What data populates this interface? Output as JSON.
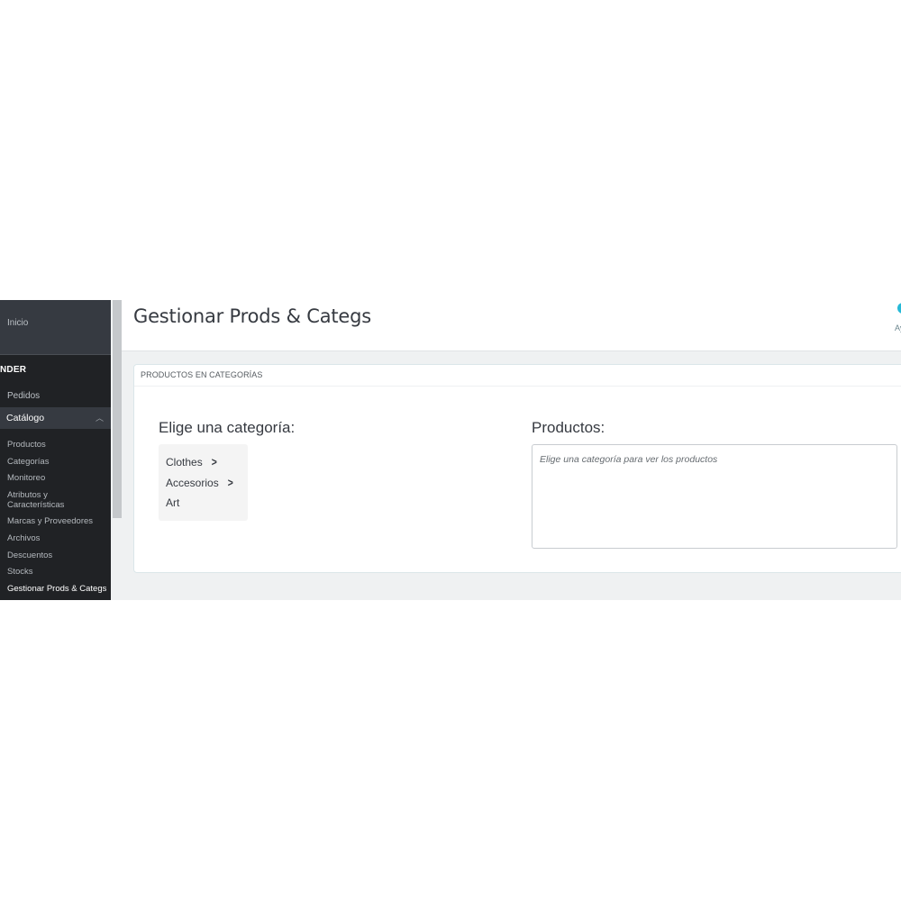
{
  "sidebar": {
    "home": "Inicio",
    "section": "NDER",
    "orders": "Pedidos",
    "catalog": "Catálogo",
    "catalog_items": [
      "Productos",
      "Categorías",
      "Monitoreo",
      "Atributos y",
      "Características",
      "Marcas y Proveedores",
      "Archivos",
      "Descuentos",
      "Stocks",
      "Gestionar Prods & Categs"
    ]
  },
  "header": {
    "title": "Gestionar Prods & Categs",
    "help_label": "Ay"
  },
  "panel": {
    "title": "PRODUCTOS EN CATEGORÍAS",
    "categories_label": "Elige una categoría:",
    "categories": [
      "Clothes",
      "Accesorios",
      "Art"
    ],
    "products_label": "Productos:",
    "products_hint": "Elige una categoría para ver los productos"
  },
  "colors": {
    "sidebar_bg": "#202225",
    "accent": "#25b9d7"
  }
}
